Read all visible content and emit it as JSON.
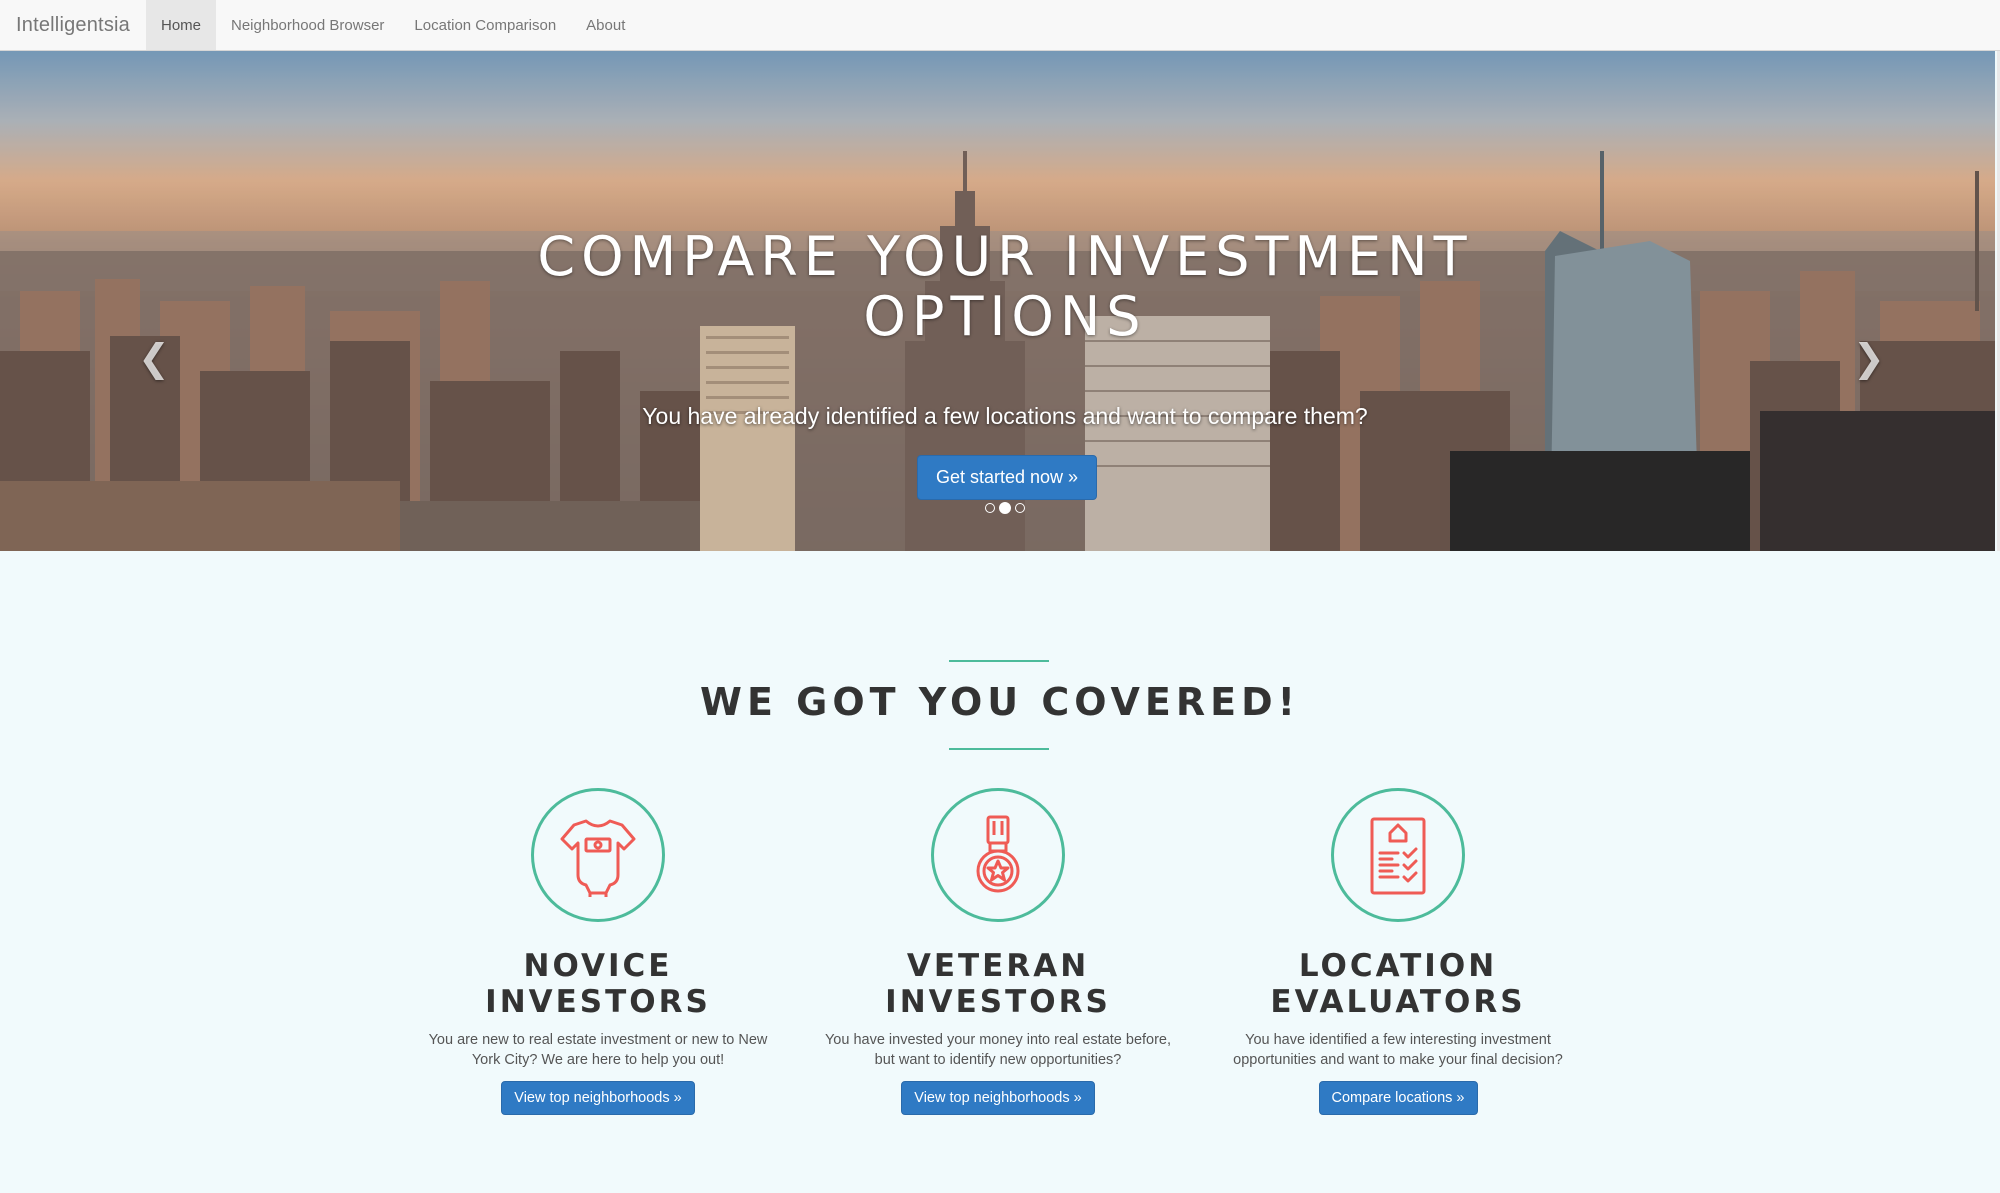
{
  "navbar": {
    "brand": "Intelligentsia",
    "items": [
      {
        "label": "Home",
        "active": true
      },
      {
        "label": "Neighborhood Browser",
        "active": false
      },
      {
        "label": "Location Comparison",
        "active": false
      },
      {
        "label": "About",
        "active": false
      }
    ]
  },
  "hero": {
    "title_line1": "COMPARE YOUR INVESTMENT",
    "title_line2": "OPTIONS",
    "subtitle": "You have already identified a few locations and want to compare them?",
    "button_label": "Get started now »",
    "prev_icon": "chevron-left-icon",
    "next_icon": "chevron-right-icon",
    "slide_count": 3,
    "active_slide": 2
  },
  "section": {
    "title": "WE GOT YOU COVERED!"
  },
  "cards": [
    {
      "icon": "baby-onesie-icon",
      "title_line1": "NOVICE",
      "title_line2": "INVESTORS",
      "text": "You are new to real estate investment or new to New York City? We are here to help you out!",
      "button_label": "View top neighborhoods »"
    },
    {
      "icon": "medal-icon",
      "title_line1": "VETERAN",
      "title_line2": "INVESTORS",
      "text": "You have invested your money into real estate before, but want to identify new opportunities?",
      "button_label": "View top neighborhoods »"
    },
    {
      "icon": "checklist-house-icon",
      "title_line1": "LOCATION",
      "title_line2": "EVALUATORS",
      "text": "You have identified a few interesting investment opportunities and want to make your final decision?",
      "button_label": "Compare locations »"
    }
  ],
  "colors": {
    "accent_teal": "#4dbb9b",
    "icon_coral": "#ef5b55",
    "button_blue": "#2f7ac4",
    "page_background": "#f1fafc"
  }
}
